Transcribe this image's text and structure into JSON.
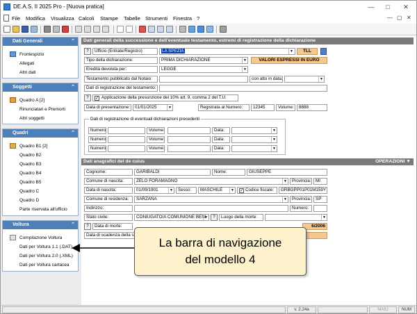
{
  "window": {
    "title": "DE.A.S. II 2025 Pro - [Nuova pratica]"
  },
  "menu": [
    "File",
    "Modifica",
    "Visualizza",
    "Calcoli",
    "Stampe",
    "Tabelle",
    "Strumenti",
    "Finestra",
    "?"
  ],
  "sidebar": {
    "groups": [
      {
        "title": "Dati Generali",
        "items": [
          "Frontespizio",
          "Allegati",
          "Altri dati"
        ]
      },
      {
        "title": "Soggetti",
        "items": [
          "Quadro A [2]",
          "Rinunciatari e Premorti",
          "Altri soggetti"
        ]
      },
      {
        "title": "Quadri",
        "items": [
          "Quadro B1 [2]",
          "Quadro B2",
          "Quadro B3",
          "Quadro B4",
          "Quadro B5",
          "Quadro C",
          "Quadro D",
          "Parte riservata all'ufficio"
        ]
      },
      {
        "title": "Voltura",
        "items": [
          "Compilazione Voltura",
          "Dati per Voltura 1.1 (.DAT)",
          "Dati per Voltura 2.0 (.XML)",
          "Dati per Voltura cartacea"
        ]
      }
    ]
  },
  "section1": {
    "title": "Dati generali della successione e dell'eventuale testamento, estremi di registrazione della dichiarazione",
    "ufficio_label": "Ufficio (Entrate/Registro)",
    "ufficio_value": "LA SPEZIA",
    "ufficio_code": "TLL",
    "tipo_label": "Tipo della dichiarazione:",
    "tipo_value": "PRIMA DICHIARAZIONE",
    "valori_label": "VALORI ESPRESSI IN EURO",
    "eredita_label": "Eredità devoluta per:",
    "eredita_value": "LEGGE",
    "testamento_label": "Testamento pubblicato dal Notaio:",
    "atto_label": "con atto in data:",
    "registrazione_label": "Dati di registrazione del testamento:",
    "presunzione_label": "Applicazione della presunzione del 10% art. 9, comma 2 del T.U.",
    "data_presentazione_label": "Data di presentazione:",
    "data_presentazione_value": "01/01/2025",
    "registrata_label": "Registrata al Numero:",
    "registrata_value": "12345",
    "volume_label": "Volume:",
    "volume_value": "8888",
    "precedenti_title": "Dati di registrazione di eventuali dichiarazioni precedenti",
    "numero_label": "Numero:",
    "data_label": "Data:"
  },
  "section2": {
    "title": "Dati anagrafici del de cuius",
    "operazioni": "OPERAZIONI",
    "cognome_label": "Cognome:",
    "cognome_value": "GARIBALDI",
    "nome_label": "Nome:",
    "nome_value": "GIUSEPPE",
    "comune_nascita_label": "Comune di nascita:",
    "comune_nascita_value": "ZELO FORAMAGNO",
    "provincia_label": "Provincia:",
    "provincia_nascita_value": "MI",
    "data_nascita_label": "Data di nascita:",
    "data_nascita_value": "01/09/1901",
    "sesso_label": "Sesso:",
    "sesso_value": "MASCHILE",
    "codice_fiscale_label": "Codice fiscale:",
    "codice_fiscale_value": "GRBGPP01P01M159Y",
    "comune_residenza_label": "Comune di residenza:",
    "comune_residenza_value": "SARZANA",
    "provincia_residenza_value": "SP",
    "indirizzo_label": "Indirizzo:",
    "numero_label": "Numero:",
    "stato_civile_label": "Stato civile:",
    "stato_civile_value": "CONIUGATO/A COMUNIONE BENI",
    "luogo_morte_label": "Luogo della morte:",
    "data_morte_label": "Data di morte:",
    "data_morte_partial": "6/2006",
    "scadenza_label": "Data di scadenza della s"
  },
  "callout": {
    "line1": "La barra di navigazione",
    "line2": "del modello 4"
  },
  "status": {
    "version": "v. 2.24a",
    "maiu": "MAIU",
    "num": "NUM"
  },
  "colors": {
    "sidebar_header": "#4d7fb9",
    "section_header": "#7a7a7a",
    "highlight": "#f4c88e",
    "selection": "#0a3ea6"
  }
}
